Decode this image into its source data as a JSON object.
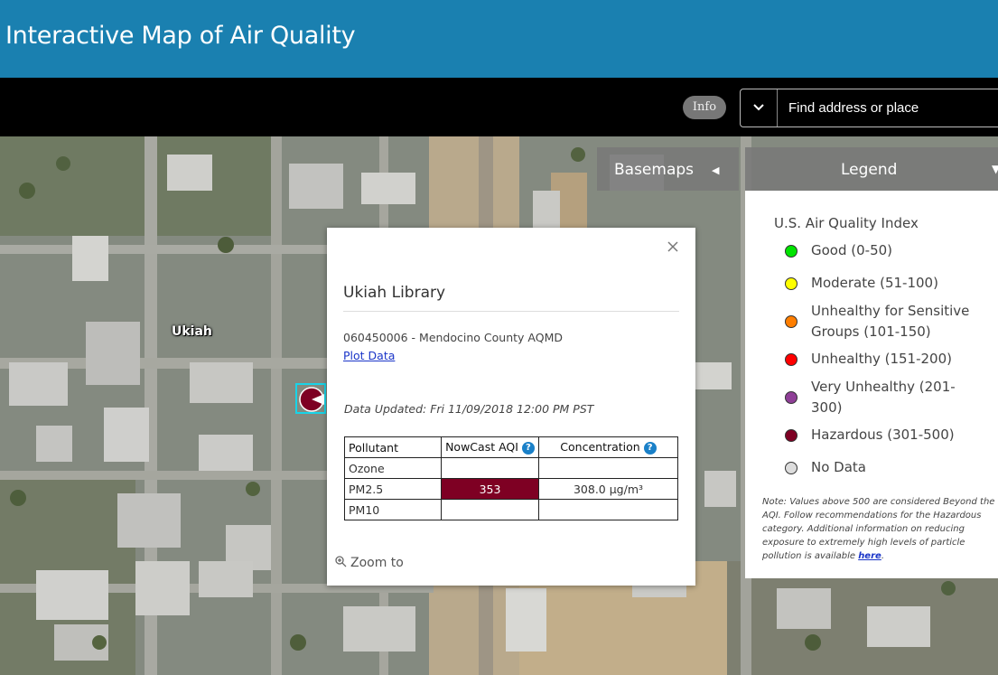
{
  "header": {
    "title": "Interactive Map of Air Quality"
  },
  "toolbar": {
    "info_label": "Info",
    "search_placeholder": "Find address or place"
  },
  "map": {
    "place_label": "Ukiah",
    "marker_color": "#7e0023"
  },
  "popup": {
    "title": "Ukiah Library",
    "site": "060450006 - Mendocino County AQMD",
    "plot_link": "Plot Data",
    "updated": "Data Updated: Fri 11/09/2018 12:00 PM PST",
    "table": {
      "headers": [
        "Pollutant",
        "NowCast AQI",
        "Concentration"
      ],
      "rows": [
        {
          "pollutant": "Ozone",
          "aqi": "",
          "conc": ""
        },
        {
          "pollutant": "PM2.5",
          "aqi": "353",
          "conc": "308.0 µg/m³"
        },
        {
          "pollutant": "PM10",
          "aqi": "",
          "conc": ""
        }
      ]
    },
    "zoom_label": "Zoom to"
  },
  "tabs": {
    "basemaps": "Basemaps",
    "legend": "Legend"
  },
  "legend": {
    "heading": "U.S. Air Quality Index",
    "items": [
      {
        "label": "Good (0-50)",
        "color": "#00e400"
      },
      {
        "label": "Moderate (51-100)",
        "color": "#ffff00"
      },
      {
        "label": "Unhealthy for Sensitive Groups (101-150)",
        "color": "#ff7e00"
      },
      {
        "label": "Unhealthy (151-200)",
        "color": "#ff0000"
      },
      {
        "label": "Very Unhealthy (201-300)",
        "color": "#8f3f97"
      },
      {
        "label": "Hazardous (301-500)",
        "color": "#7e0023"
      },
      {
        "label": "No Data",
        "color": "#dddddd"
      }
    ],
    "note_text": "Note: Values above 500 are considered Beyond the AQI. Follow recommendations for the Hazardous category. Additional information on reducing exposure to extremely high levels of particle pollution is available",
    "note_link": "here",
    "note_end": "."
  }
}
